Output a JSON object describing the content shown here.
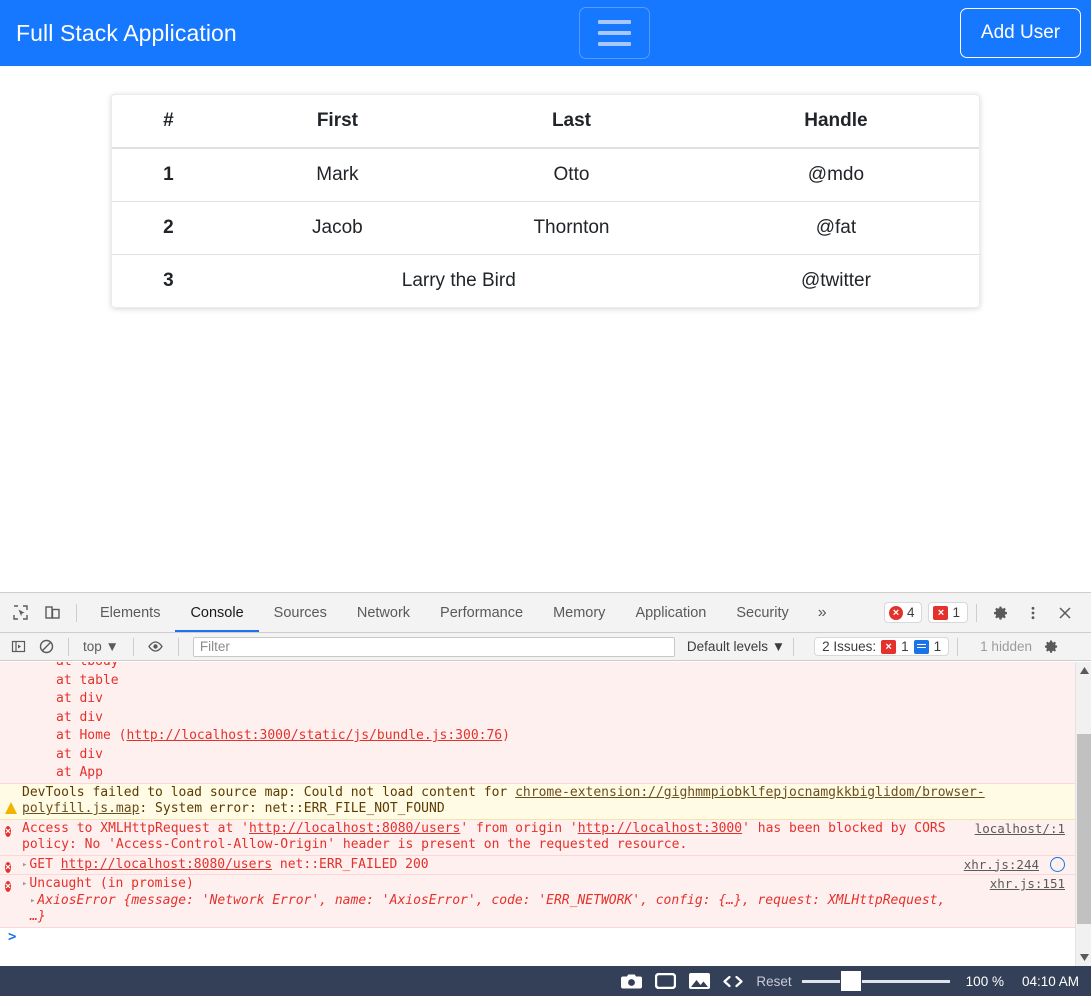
{
  "app": {
    "navbar": {
      "brand": "Full Stack Application",
      "toggler_icon": "hamburger-icon",
      "add_user_label": "Add User",
      "brand_color": "#ffffff",
      "background_color": "#1677ff"
    },
    "table": {
      "headers": [
        "#",
        "First",
        "Last",
        "Handle"
      ],
      "rows": [
        {
          "num": "1",
          "first": "Mark",
          "last": "Otto",
          "handle": "@mdo",
          "span": false
        },
        {
          "num": "2",
          "first": "Jacob",
          "last": "Thornton",
          "handle": "@fat",
          "span": false
        },
        {
          "num": "3",
          "first": "Larry the Bird",
          "last": "",
          "handle": "@twitter",
          "span": true
        }
      ]
    }
  },
  "devtools": {
    "toolbar": {
      "inspect_icon": "inspect-element-icon",
      "device_icon": "device-toolbar-icon",
      "tabs": [
        {
          "label": "Elements",
          "active": false
        },
        {
          "label": "Console",
          "active": true
        },
        {
          "label": "Sources",
          "active": false
        },
        {
          "label": "Network",
          "active": false
        },
        {
          "label": "Performance",
          "active": false
        },
        {
          "label": "Memory",
          "active": false
        },
        {
          "label": "Application",
          "active": false
        },
        {
          "label": "Security",
          "active": false
        }
      ],
      "more_tabs": "»",
      "error_count": "4",
      "issue_count": "1",
      "settings_icon": "gear-icon",
      "more_icon": "kebab-menu-icon",
      "close_icon": "close-icon"
    },
    "filterbar": {
      "sidebar_icon": "console-sidebar-icon",
      "clear_icon": "clear-console-icon",
      "context": "top",
      "context_caret": "▼",
      "eye_icon": "live-expression-icon",
      "filter_value": "",
      "filter_placeholder": "Filter",
      "levels_label": "Default levels",
      "levels_caret": "▼",
      "issues_label": "2 Issues:",
      "issues_error_count": "1",
      "issues_info_count": "1",
      "hidden_label": "1 hidden",
      "settings_icon": "gear-icon"
    },
    "console": {
      "messages": [
        {
          "kind": "error-stack",
          "text": "at tbody",
          "clipped": true
        },
        {
          "kind": "error-stack",
          "text": "at table"
        },
        {
          "kind": "error-stack",
          "text": "at div"
        },
        {
          "kind": "error-stack",
          "text": "at div"
        },
        {
          "kind": "error-stack-link",
          "pre": "at Home (",
          "link": "http://localhost:3000/static/js/bundle.js:300:76",
          "post": ")"
        },
        {
          "kind": "error-stack",
          "text": "at div"
        },
        {
          "kind": "error-stack",
          "text": "at App"
        }
      ],
      "warning": {
        "icon": "warning-triangle-icon",
        "part1": "DevTools failed to load source map: Could not load content for ",
        "link": "chrome-extension://gighmmpiobklfepjocnamgkkbiglidom/browser-polyfill.js.map",
        "part2": ": System error: net::ERR_FILE_NOT_FOUND"
      },
      "cors_error": {
        "icon": "error-circle-icon",
        "pre": "Access to XMLHttpRequest at '",
        "url1": "http://localhost:8080/users",
        "mid": "' from origin '",
        "url2": "http://localhost:3000",
        "post": "' has been blocked by CORS policy: No 'Access-Control-Allow-Origin' header is present on the requested resource.",
        "source": "localhost/:1"
      },
      "get_error": {
        "icon": "error-circle-icon",
        "disclosure": "▸",
        "method": "GET ",
        "url": "http://localhost:8080/users",
        "status": " net::ERR_FAILED 200",
        "source": "xhr.js:244",
        "network_icon": "network-request-icon"
      },
      "uncaught_error": {
        "icon": "error-circle-icon",
        "disclosure": "▸",
        "title": "Uncaught (in promise)",
        "source": "xhr.js:151",
        "object_disclosure": "▸",
        "object_name": "AxiosError ",
        "object_body": "{message: 'Network Error', name: 'AxiosError', code: 'ERR_NETWORK', config: {…}, request: XMLHttpRequest, …}"
      },
      "prompt": ">"
    }
  },
  "statusbar": {
    "camera_icon": "camera-icon",
    "screen_icon": "screen-icon",
    "image_icon": "image-icon",
    "code_icon": "code-icon",
    "reset_label": "Reset",
    "zoom_value": "100 %",
    "time": "04:10 AM",
    "background_color": "#343f58"
  }
}
